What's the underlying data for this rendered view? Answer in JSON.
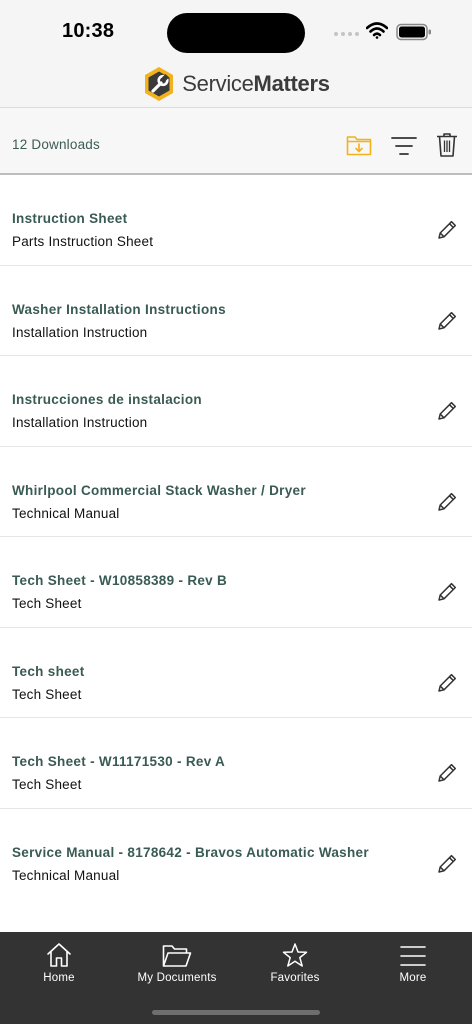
{
  "status_bar": {
    "time": "10:38"
  },
  "header": {
    "brand_light": "Service",
    "brand_bold": "Matters"
  },
  "toolbar": {
    "downloads_count": "12 Downloads"
  },
  "items": [
    {
      "title": "Instruction Sheet",
      "subtitle": "Parts Instruction Sheet"
    },
    {
      "title": "Washer Installation Instructions",
      "subtitle": "Installation Instruction"
    },
    {
      "title": "Instrucciones de instalacion",
      "subtitle": "Installation Instruction"
    },
    {
      "title": "Whirlpool Commercial Stack Washer / Dryer",
      "subtitle": "Technical Manual"
    },
    {
      "title": "Tech Sheet - W10858389 - Rev B",
      "subtitle": "Tech Sheet"
    },
    {
      "title": "Tech sheet",
      "subtitle": "Tech Sheet"
    },
    {
      "title": "Tech Sheet - W11171530 - Rev A",
      "subtitle": "Tech Sheet"
    },
    {
      "title": "Service Manual - 8178642 - Bravos Automatic Washer",
      "subtitle": "Technical Manual"
    }
  ],
  "tabbar": {
    "tabs": [
      {
        "label": "Home",
        "icon": "home-icon"
      },
      {
        "label": "My Documents",
        "icon": "folder-icon"
      },
      {
        "label": "Favorites",
        "icon": "star-icon"
      },
      {
        "label": "More",
        "icon": "menu-icon"
      }
    ]
  },
  "colors": {
    "accent": "#f2b21b",
    "title_text": "#3a5a54",
    "tabbar_bg": "#333333"
  }
}
